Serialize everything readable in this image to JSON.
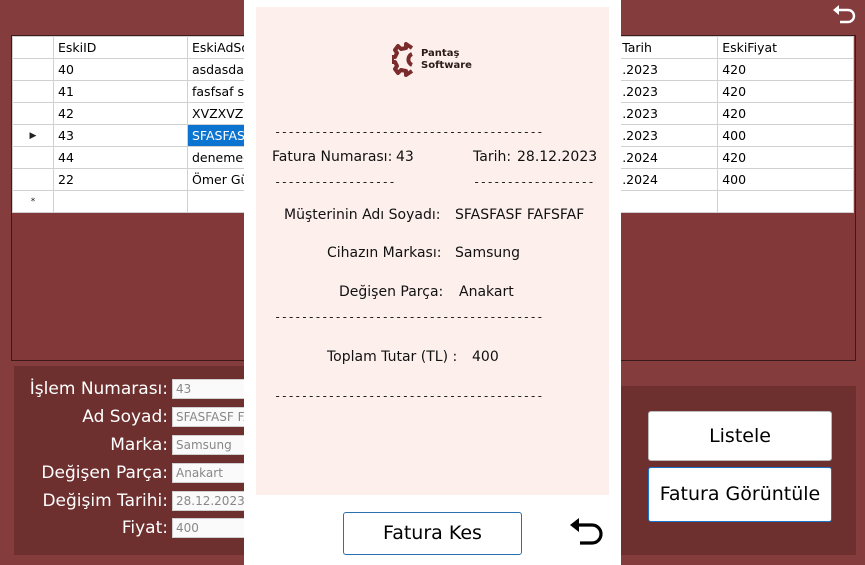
{
  "window": {
    "back_icon": "undo-arrow-icon"
  },
  "grid": {
    "columns": [
      "",
      "EskiID",
      "EskiAdSoyad",
      "",
      "",
      "EskiTarih",
      "EskiFiyat"
    ],
    "visible_headers": {
      "id": "EskiID",
      "adsoyad": "EskiAdSo",
      "tarih": "Tarih",
      "fiyat": "EskiFiyat"
    },
    "rows": [
      {
        "marker": "",
        "id": "40",
        "adsoyad": "asdasdas",
        "tarih": ".2023",
        "fiyat": "420"
      },
      {
        "marker": "",
        "id": "41",
        "adsoyad": "fasfsaf sa",
        "tarih": ".2023",
        "fiyat": "420"
      },
      {
        "marker": "",
        "id": "42",
        "adsoyad": "XVZXVZX",
        "tarih": ".2023",
        "fiyat": "420"
      },
      {
        "marker": "▶",
        "id": "43",
        "adsoyad": "SFASFASF",
        "tarih": ".2023",
        "fiyat": "400"
      },
      {
        "marker": "",
        "id": "44",
        "adsoyad": "denemee",
        "tarih": ".2024",
        "fiyat": "420"
      },
      {
        "marker": "",
        "id": "22",
        "adsoyad": "Ömer Gü",
        "tarih": ".2024",
        "fiyat": "400"
      },
      {
        "marker": "*",
        "id": "",
        "adsoyad": "",
        "tarih": "",
        "fiyat": ""
      }
    ],
    "selected_row": 3
  },
  "form": {
    "islem_label": "İşlem Numarası:",
    "islem_value": "43",
    "adsoyad_label": "Ad Soyad:",
    "adsoyad_value": "SFASFASF FA",
    "marka_label": "Marka:",
    "marka_value": "Samsung",
    "parca_label": "Değişen Parça:",
    "parca_value": "Anakart",
    "tarih_label": "Değişim Tarihi:",
    "tarih_value": "28.12.2023 0",
    "fiyat_label": "Fiyat:",
    "fiyat_value": "400"
  },
  "buttons": {
    "listele": "Listele",
    "fatura_goruntule": "Fatura Görüntüle"
  },
  "invoice": {
    "logo_line1": "Pantaş",
    "logo_line2": "Software",
    "logo_icon": "gear-logo-icon",
    "dashes_long": "----------------------------------------",
    "dashes_short": "------------------",
    "fatura_no_label": "Fatura Numarası:",
    "fatura_no": "43",
    "tarih_label": "Tarih:",
    "tarih": "28.12.2023",
    "musteri_label": "Müşterinin Adı Soyadı:",
    "musteri": "SFASFASF FAFSFAF",
    "cihaz_label": "Cihazın Markası:",
    "cihaz": "Samsung",
    "parca_label": "Değişen Parça:",
    "parca": "Anakart",
    "toplam_label": "Toplam Tutar (TL) :",
    "toplam": "400",
    "fatura_kes": "Fatura Kes",
    "back_icon": "undo-arrow-icon"
  },
  "colors": {
    "background": "#843c3c",
    "panel": "#6e2f2f",
    "selection": "#0b74d0",
    "invoice_bg": "#fdf0ec"
  }
}
